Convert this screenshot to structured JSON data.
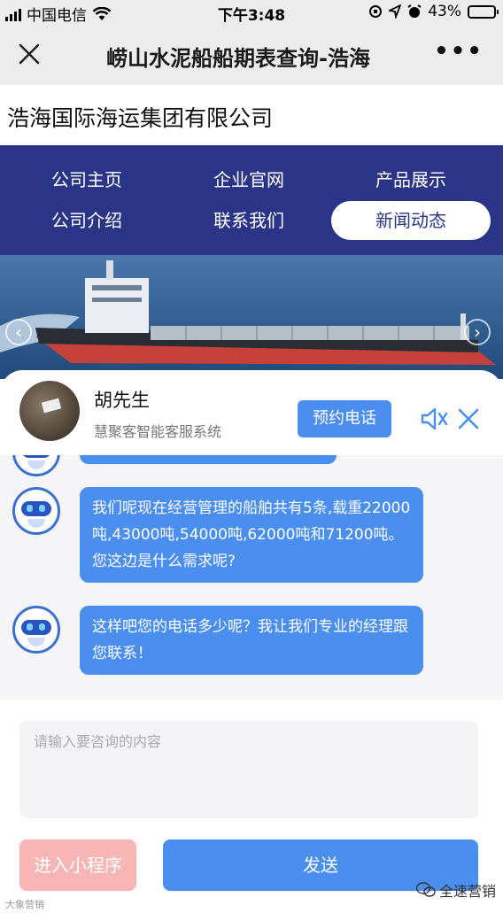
{
  "status_bar": {
    "carrier": "中国电信",
    "time": "下午3:48",
    "battery": "43%",
    "battery_level": 0.43
  },
  "nav": {
    "title": "崂山水泥船船期表查询-浩海"
  },
  "company": {
    "name": "浩海国际海运集团有限公司"
  },
  "menu": {
    "items": [
      {
        "label": "公司主页",
        "active": false
      },
      {
        "label": "企业官网",
        "active": false
      },
      {
        "label": "产品展示",
        "active": false
      },
      {
        "label": "公司介绍",
        "active": false
      },
      {
        "label": "联系我们",
        "active": false
      },
      {
        "label": "新闻动态",
        "active": true
      }
    ]
  },
  "chat": {
    "agent_name": "胡先生",
    "agent_subtitle": "慧聚客智能客服系统",
    "book_call": "预约电话",
    "messages": [
      {
        "text": "我们呢现在经营管理的船舶共有5条,载重22000吨,43000吨,54000吨,62000吨和71200吨。您这边是什么需求呢?"
      },
      {
        "text": "这样吧您的电话多少呢？我让我们专业的经理跟您联系！"
      }
    ],
    "input_placeholder": "请输入要咨询的内容",
    "mini_program_button": "进入小程序",
    "send_button": "发送"
  },
  "watermark": {
    "right": "全速营销",
    "left": "大象营销"
  },
  "colors": {
    "menu_bg": "#2a3588",
    "accent_blue": "#4a8ef0",
    "mini_button": "#f7b5b5"
  }
}
